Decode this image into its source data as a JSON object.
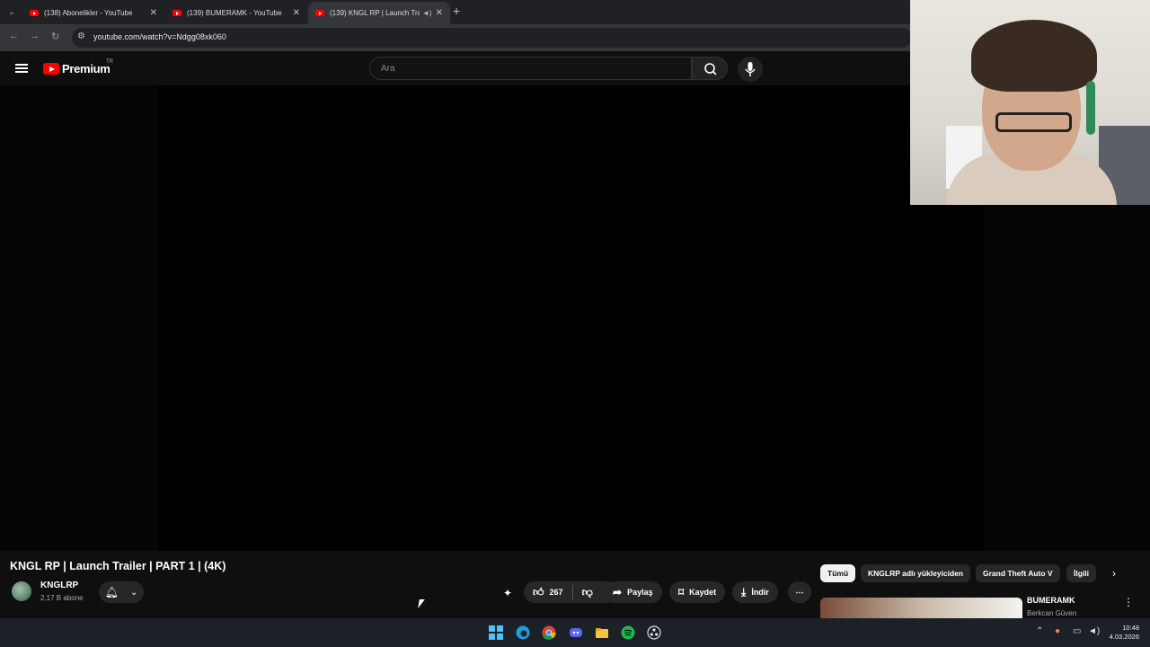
{
  "browser": {
    "tabs": [
      {
        "title": "(138) Abonelikler - YouTube"
      },
      {
        "title": "(139) BUMERAMK - YouTube"
      },
      {
        "title": "(139) KNGL RP | Launch Tra"
      }
    ],
    "url": "youtube.com/watch?v=Ndgg08xk060"
  },
  "youtube": {
    "logo_text": "Premium",
    "country_code": "TR",
    "search_placeholder": "Ara"
  },
  "video": {
    "title": "KNGL RP | Launch Trailer | PART 1 | (4K)",
    "channel": "KNGLRP",
    "subscribers": "2,17 B abone",
    "likes": "267",
    "share_label": "Paylaş",
    "save_label": "Kaydet",
    "download_label": "İndir"
  },
  "filter_chips": [
    "Tümü",
    "KNGLRP adlı yükleyiciden",
    "Grand Theft Auto V",
    "İlgili"
  ],
  "related": {
    "title": "BUMERAMK",
    "channel": "Berkcan Güven"
  },
  "taskbar": {
    "time": "10:48",
    "date": "4.03.2026"
  }
}
